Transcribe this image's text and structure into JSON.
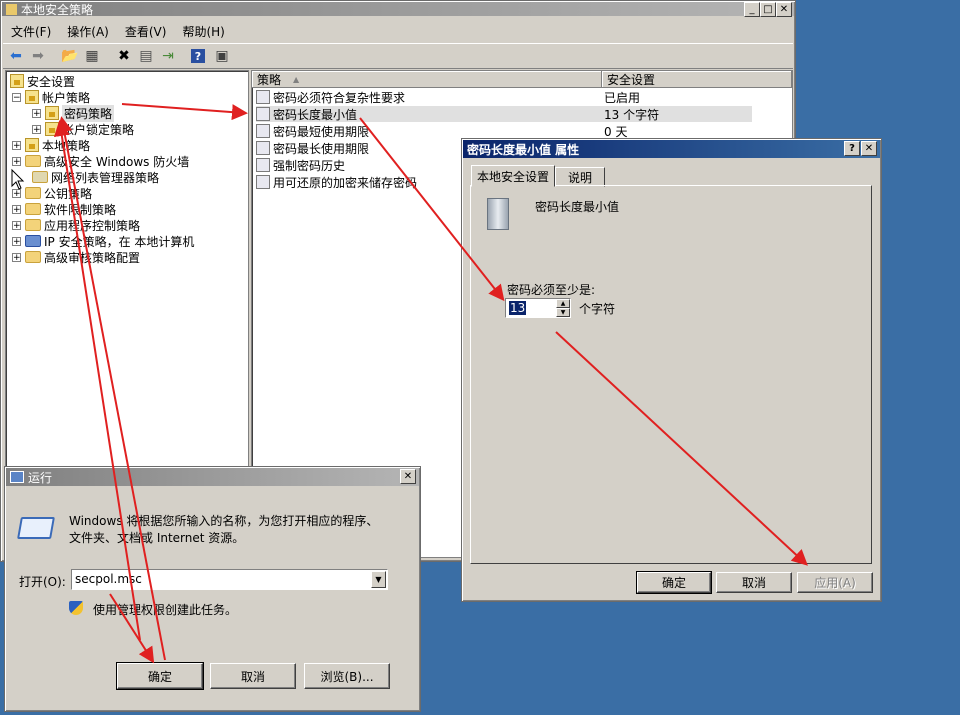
{
  "main_window": {
    "title": "本地安全策略",
    "menus": [
      "文件(F)",
      "操作(A)",
      "查看(V)",
      "帮助(H)"
    ],
    "tree": [
      {
        "label": "安全设置",
        "level": 0
      },
      {
        "label": "帐户策略",
        "level": 1
      },
      {
        "label": "密码策略",
        "level": 2,
        "selected": true
      },
      {
        "label": "帐户锁定策略",
        "level": 2
      },
      {
        "label": "本地策略",
        "level": 1
      },
      {
        "label": "高级安全 Windows 防火墙",
        "level": 1
      },
      {
        "label": "网络列表管理器策略",
        "level": 1
      },
      {
        "label": "公钥策略",
        "level": 1
      },
      {
        "label": "软件限制策略",
        "level": 1
      },
      {
        "label": "应用程序控制策略",
        "level": 1
      },
      {
        "label": "IP 安全策略，在 本地计算机",
        "level": 1
      },
      {
        "label": "高级审核策略配置",
        "level": 1
      }
    ],
    "columns": {
      "policy": "策略",
      "setting": "安全设置"
    },
    "rows": [
      {
        "policy": "密码必须符合复杂性要求",
        "setting": "已启用"
      },
      {
        "policy": "密码长度最小值",
        "setting": "13 个字符",
        "selected": true
      },
      {
        "policy": "密码最短使用期限",
        "setting": "0 天"
      },
      {
        "policy": "密码最长使用期限",
        "setting": ""
      },
      {
        "policy": "强制密码历史",
        "setting": ""
      },
      {
        "policy": "用可还原的加密来储存密码",
        "setting": ""
      }
    ]
  },
  "props_dialog": {
    "title": "密码长度最小值 属性",
    "tabs": [
      "本地安全设置",
      "说明"
    ],
    "heading": "密码长度最小值",
    "prompt": "密码必须至少是:",
    "value": "13",
    "unit": "个字符",
    "ok": "确定",
    "cancel": "取消",
    "apply": "应用(A)"
  },
  "run_dialog": {
    "title": "运行",
    "description": "Windows 将根据您所输入的名称，为您打开相应的程序、文件夹、文档或 Internet 资源。",
    "open_label": "打开(O):",
    "command": "secpol.msc",
    "admin_note": "使用管理权限创建此任务。",
    "ok": "确定",
    "cancel": "取消",
    "browse": "浏览(B)..."
  },
  "colors": {
    "arrow": "#e02020",
    "selection": "#e0e0e0",
    "title_active": "#0a246a"
  }
}
